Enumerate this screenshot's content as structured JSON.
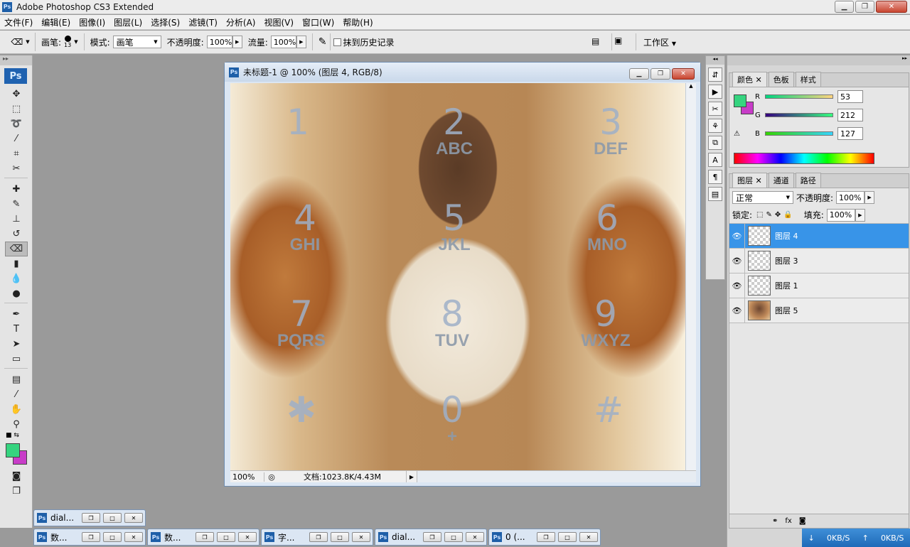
{
  "window": {
    "title": "Adobe Photoshop CS3 Extended",
    "app_badge": "Ps"
  },
  "menu": [
    "文件(F)",
    "编辑(E)",
    "图像(I)",
    "图层(L)",
    "选择(S)",
    "滤镜(T)",
    "分析(A)",
    "视图(V)",
    "窗口(W)",
    "帮助(H)"
  ],
  "options": {
    "brush_label": "画笔:",
    "brush_size": "13",
    "mode_label": "模式:",
    "mode_value": "画笔",
    "opacity_label": "不透明度:",
    "opacity_value": "100%",
    "flow_label": "流量:",
    "flow_value": "100%",
    "history_label": "抹到历史记录",
    "workspace_label": "工作区"
  },
  "toolbox": {
    "logo": "Ps"
  },
  "document": {
    "title": "未标题-1 @ 100% (图层 4, RGB/8)",
    "zoom": "100%",
    "doc_info": "文档:1023.8K/4.43M",
    "dial": [
      {
        "num": "1",
        "letters": ""
      },
      {
        "num": "2",
        "letters": "ABC"
      },
      {
        "num": "3",
        "letters": "DEF"
      },
      {
        "num": "4",
        "letters": "GHI"
      },
      {
        "num": "5",
        "letters": "JKL"
      },
      {
        "num": "6",
        "letters": "MNO"
      },
      {
        "num": "7",
        "letters": "PQRS"
      },
      {
        "num": "8",
        "letters": "TUV"
      },
      {
        "num": "9",
        "letters": "WXYZ"
      },
      {
        "num": "✱",
        "letters": ""
      },
      {
        "num": "0",
        "letters": "+"
      },
      {
        "num": "#",
        "letters": ""
      }
    ]
  },
  "color_panel": {
    "tabs": [
      "颜色",
      "色板",
      "样式"
    ],
    "r_label": "R",
    "r_value": "53",
    "g_label": "G",
    "g_value": "212",
    "b_label": "B",
    "b_value": "127",
    "fg_color": "#35d47f",
    "bg_color": "#c83cc8"
  },
  "layers_panel": {
    "tabs": [
      "图层",
      "通道",
      "路径"
    ],
    "blend_mode": "正常",
    "opacity_label": "不透明度:",
    "opacity_value": "100%",
    "lock_label": "锁定:",
    "fill_label": "填充:",
    "fill_value": "100%",
    "layers": [
      {
        "name": "图层 4",
        "selected": true
      },
      {
        "name": "图层 3",
        "selected": false
      },
      {
        "name": "图层 1",
        "selected": false
      },
      {
        "name": "图层 5",
        "selected": false
      }
    ]
  },
  "minimized_docs": [
    {
      "label": "dial..."
    },
    {
      "label": "数..."
    },
    {
      "label": "数..."
    },
    {
      "label": "字..."
    },
    {
      "label": "dial..."
    },
    {
      "label": "0 (..."
    }
  ],
  "network": {
    "down": "0KB/S",
    "up": "0KB/S"
  }
}
